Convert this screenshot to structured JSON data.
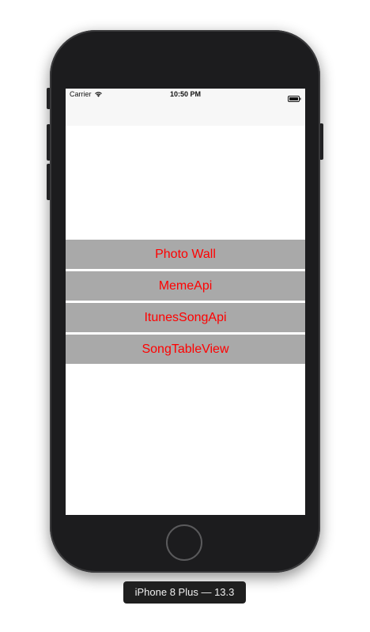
{
  "status_bar": {
    "carrier": "Carrier",
    "time": "10:50 PM",
    "wifi_icon": "wifi-icon",
    "battery_icon": "battery-icon"
  },
  "menu": {
    "items": [
      {
        "label": "Photo Wall"
      },
      {
        "label": "MemeApi"
      },
      {
        "label": "ItunesSongApi"
      },
      {
        "label": "SongTableView"
      }
    ]
  },
  "device": {
    "label": "iPhone 8 Plus — 13.3"
  },
  "colors": {
    "button_bg": "#a9a9a9",
    "button_text": "#ff0000",
    "status_bar_bg": "#f7f7f7",
    "phone_body": "#1c1c1e"
  }
}
